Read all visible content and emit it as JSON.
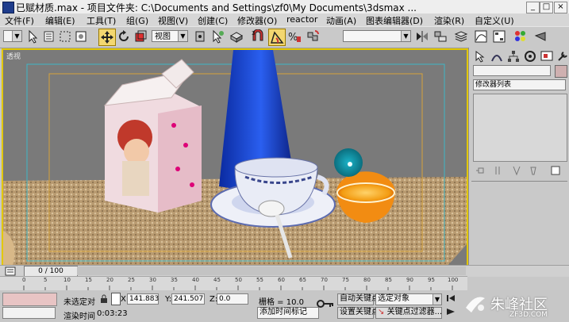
{
  "window": {
    "title": "已赋材质.max   - 项目文件夹: C:\\Documents and Settings\\zf0\\My Documents\\3dsmax ...",
    "min": "_",
    "max": "□",
    "close": "×"
  },
  "menu": [
    "文件(F)",
    "编辑(E)",
    "工具(T)",
    "组(G)",
    "视图(V)",
    "创建(C)",
    "修改器(O)",
    "reactor",
    "动画(A)",
    "图表编辑器(D)",
    "渲染(R)",
    "自定义(U)"
  ],
  "toolbar": {
    "view_dropdown": "视图",
    "selection_set": ""
  },
  "viewport": {
    "label": "透视"
  },
  "command_panel": {
    "object_name": "",
    "modifier_list": "修改器列表"
  },
  "timeline": {
    "frame_counter": "0 / 100"
  },
  "ruler": [
    "0",
    "5",
    "10",
    "15",
    "20",
    "25",
    "30",
    "35",
    "40",
    "45",
    "50",
    "55",
    "60",
    "65",
    "70",
    "75",
    "80",
    "85",
    "90",
    "95",
    "100"
  ],
  "status": {
    "selection": "未选定对",
    "x_label": "X:",
    "x_value": "141.883",
    "y_label": "Y:",
    "y_value": "241.507",
    "z_label": "Z:",
    "z_value": "0.0",
    "grid": "栅格 = 10.0",
    "render_time_label": "渲染时间",
    "render_time_value": "0:03:23",
    "add_time_tag": "添加时间标记",
    "auto_key": "自动关键点",
    "selected_object": "选定对象",
    "set_key": "设置关键点",
    "key_filters": "关键点过滤器..."
  },
  "watermark": {
    "text": "朱峰社区",
    "url": "ZF3D.COM"
  },
  "colors": {
    "viewport_border": "#e2c800",
    "accent": "#f3d770"
  }
}
